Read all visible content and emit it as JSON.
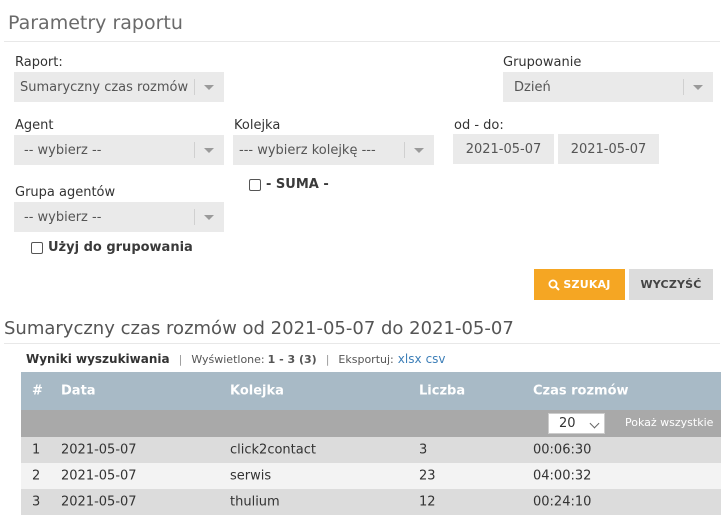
{
  "panel": {
    "title": "Parametry raportu"
  },
  "form": {
    "report": {
      "label": "Raport:",
      "value": "Sumaryczny czas rozmów"
    },
    "grouping": {
      "label": "Grupowanie",
      "value": "Dzień"
    },
    "agent": {
      "label": "Agent",
      "value": "-- wybierz --"
    },
    "queue": {
      "label": "Kolejka",
      "value": "--- wybierz kolejkę ---"
    },
    "range": {
      "label": "od - do:",
      "from": "2021-05-07",
      "to": "2021-05-07"
    },
    "sum_checkbox": {
      "label": "- SUMA -",
      "checked": false
    },
    "agent_group": {
      "label": "Grupa agentów",
      "value": "-- wybierz --"
    },
    "use_for_grouping": {
      "label": "Użyj do grupowania",
      "checked": false
    },
    "search_button": "SZUKAJ",
    "clear_button": "WYCZYŚĆ"
  },
  "results": {
    "title": "Sumaryczny czas rozmów od 2021-05-07 do 2021-05-07",
    "info": {
      "heading": "Wyniki wyszukiwania",
      "shown_label": "Wyświetlone:",
      "shown_value": "1 - 3 (3)",
      "export_label": "Eksportuj:",
      "export_xlsx": "xlsx",
      "export_csv": "csv"
    },
    "table": {
      "columns": [
        "#",
        "Data",
        "Kolejka",
        "Liczba",
        "Czas rozmów"
      ],
      "per_page": "20",
      "show_all": "Pokaż wszystkie",
      "rows": [
        [
          "1",
          "2021-05-07",
          "click2contact",
          "3",
          "00:06:30"
        ],
        [
          "2",
          "2021-05-07",
          "serwis",
          "23",
          "04:00:32"
        ],
        [
          "3",
          "2021-05-07",
          "thulium",
          "12",
          "00:24:10"
        ]
      ]
    }
  },
  "colors": {
    "accent": "#f5a623",
    "table_header": "#a8bac6",
    "link": "#3d7fb8"
  },
  "icons": {
    "search": "search-icon",
    "dropdown": "chevron-down-icon"
  }
}
